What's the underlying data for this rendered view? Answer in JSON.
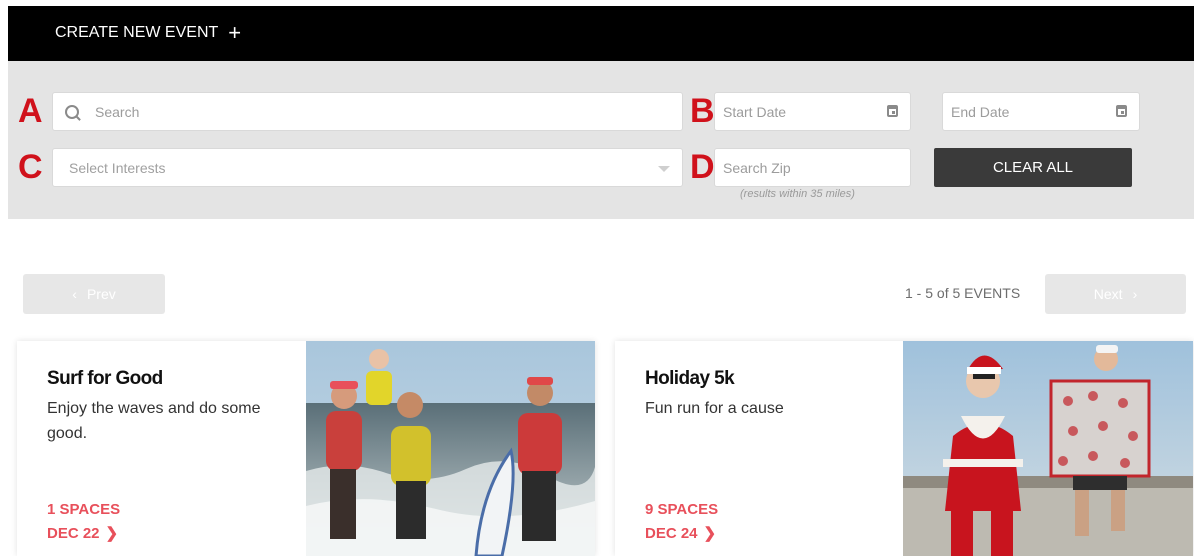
{
  "header": {
    "create_label": "CREATE NEW EVENT",
    "create_icon": "plus-icon"
  },
  "annotations": {
    "a": "A",
    "b": "B",
    "c": "C",
    "d": "D"
  },
  "filters": {
    "search_placeholder": "Search",
    "start_date_placeholder": "Start Date",
    "end_date_placeholder": "End Date",
    "interests_placeholder": "Select Interests",
    "zip_placeholder": "Search Zip",
    "zip_note": "(results within 35 miles)",
    "clear_label": "CLEAR ALL"
  },
  "pagination": {
    "prev_label": "Prev",
    "next_label": "Next",
    "count_label": "1 - 5 of 5 EVENTS"
  },
  "events": [
    {
      "title": "Surf for Good",
      "description": "Enjoy the waves and do some good.",
      "spaces": "1 SPACES",
      "date": "DEC 22"
    },
    {
      "title": "Holiday 5k",
      "description": "Fun run for a cause",
      "spaces": "9 SPACES",
      "date": "DEC 24"
    }
  ],
  "colors": {
    "accent": "#e8505b",
    "annotation_red": "#d0111b",
    "topbar": "#000000",
    "filter_bg": "#e4e4e4",
    "clear_btn": "#3a3a3a"
  }
}
